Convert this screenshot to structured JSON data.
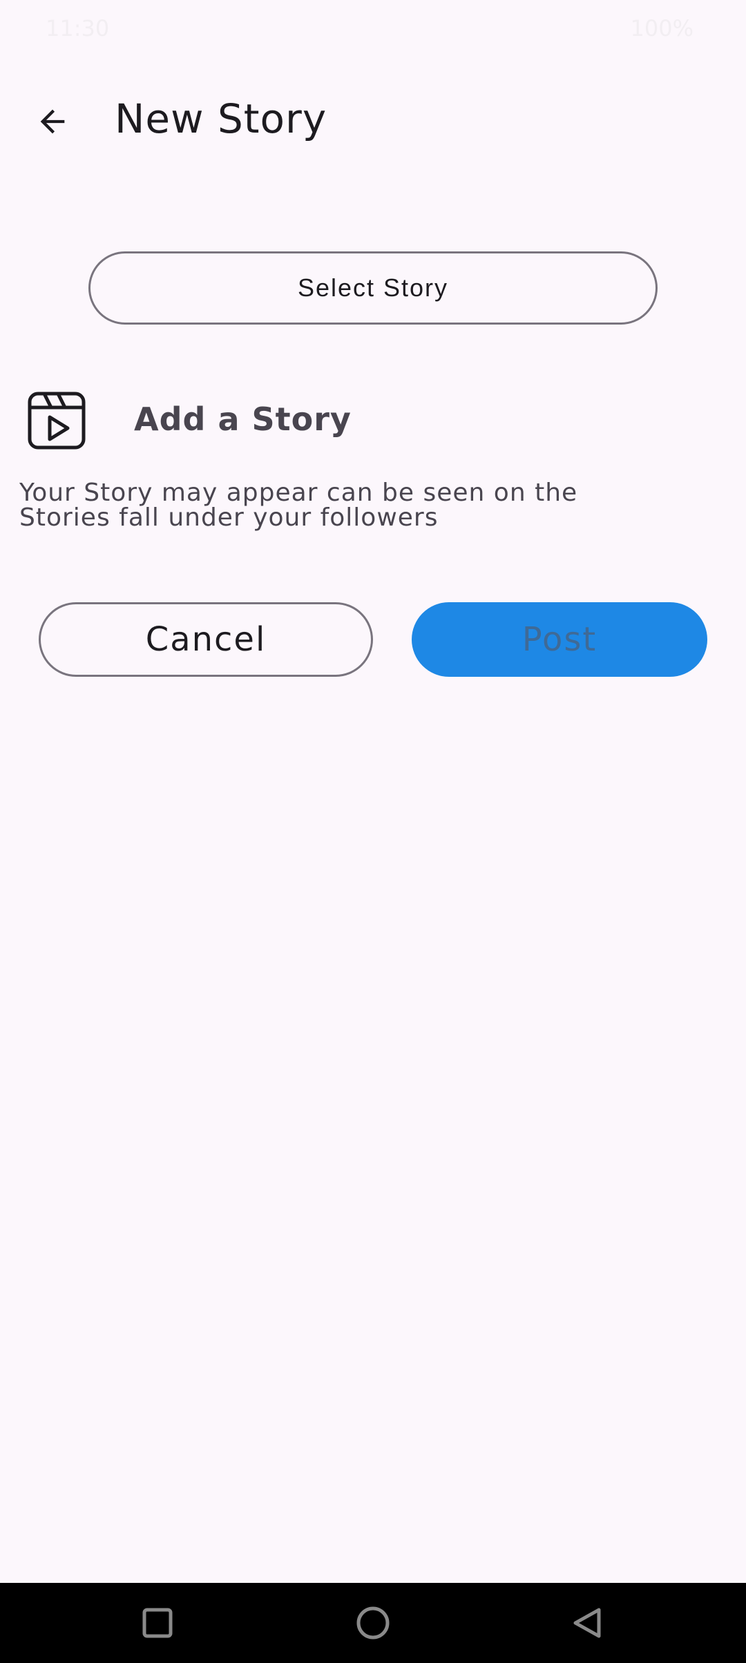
{
  "status_bar": {
    "time": "11:30",
    "battery": "100%"
  },
  "app_bar": {
    "title": "New Story"
  },
  "select_story": {
    "label": "Select Story"
  },
  "add_story": {
    "label": "Add a Story",
    "description_line1": "Your Story may appear can be seen on the",
    "description_line2": "Stories fall under your followers"
  },
  "actions": {
    "cancel_label": "Cancel",
    "post_label": "Post"
  },
  "colors": {
    "background": "#fcf7fc",
    "primary": "#1e88e5",
    "outline": "#79747e",
    "on_surface": "#1d1b20",
    "on_surface_variant": "#49454f"
  },
  "icons": {
    "back": "arrow-back-icon",
    "story": "clapperboard-play-icon",
    "nav_recents": "square-icon",
    "nav_home": "circle-icon",
    "nav_back": "triangle-back-icon"
  }
}
